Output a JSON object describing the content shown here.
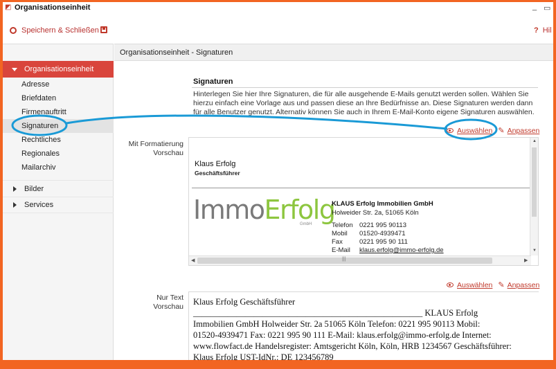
{
  "window": {
    "title": "Organisationseinheit"
  },
  "toolbar": {
    "save_close_label": "Speichern & Schließen",
    "help_label": "Hil"
  },
  "sidebar": {
    "section_label": "Organisationseinheit",
    "sub_items": [
      "Adresse",
      "Briefdaten",
      "Firmenauftritt",
      "Signaturen",
      "Rechtliches",
      "Regionales",
      "Mailarchiv"
    ],
    "active_item": "Signaturen",
    "groups": [
      "Bilder",
      "Services"
    ]
  },
  "main": {
    "breadcrumb": "Organisationseinheit - Signaturen",
    "section_title": "Signaturen",
    "description": "Hinterlegen Sie hier Ihre Signaturen, die für alle ausgehende E-Mails genutzt werden sollen. Wählen Sie hierzu einfach eine Vorlage aus und passen diese an Ihre Bedürfnisse an. Diese Signaturen werden dann für alle Benutzer genutzt. Alternativ können Sie auch in Ihrem E-Mail-Konto eigene Signaturen auswählen.",
    "select_label": "Auswählen",
    "edit_label": "Anpassen",
    "formatted_label_1": "Mit Formatierung",
    "formatted_label_2": "Vorschau",
    "plain_label_1": "Nur Text",
    "plain_label_2": "Vorschau"
  },
  "signature": {
    "name": "Klaus Erfolg",
    "role": "Geschäftsführer",
    "logo_part1": "Immo",
    "logo_part2": "Erfolg",
    "logo_sub": "GmbH",
    "company": "KLAUS Erfolg Immobilien GmbH",
    "address": "Holweider Str. 2a, 51065 Köln",
    "contacts": [
      {
        "key": "Telefon",
        "value": "0221 995 90113"
      },
      {
        "key": "Mobil",
        "value": "01520-4939471"
      },
      {
        "key": "Fax",
        "value": "0221 995 90 111"
      },
      {
        "key": "E-Mail",
        "value": "klaus.erfolg@immo-erfolg.de"
      }
    ]
  },
  "plain_text": {
    "line1": "Klaus Erfolg Geschäftsführer",
    "line2": "_____________________________________________________ KLAUS Erfolg",
    "line3": "Immobilien GmbH Holweider Str. 2a 51065 Köln Telefon: 0221 995 90113 Mobil:",
    "line4": "01520-4939471 Fax: 0221 995 90 111 E-Mail: klaus.erfolg@immo-erfolg.de Internet:",
    "line5": "www.flowfact.de Handelsregister: Amtsgericht Köln, Köln, HRB 1234567 Geschäftsführer:",
    "line6": "Klaus Erfolg UST-IdNr.: DE 123456789"
  },
  "colors": {
    "accent": "#d9453c",
    "annotation": "#1a9ad6",
    "border": "#f26522"
  }
}
